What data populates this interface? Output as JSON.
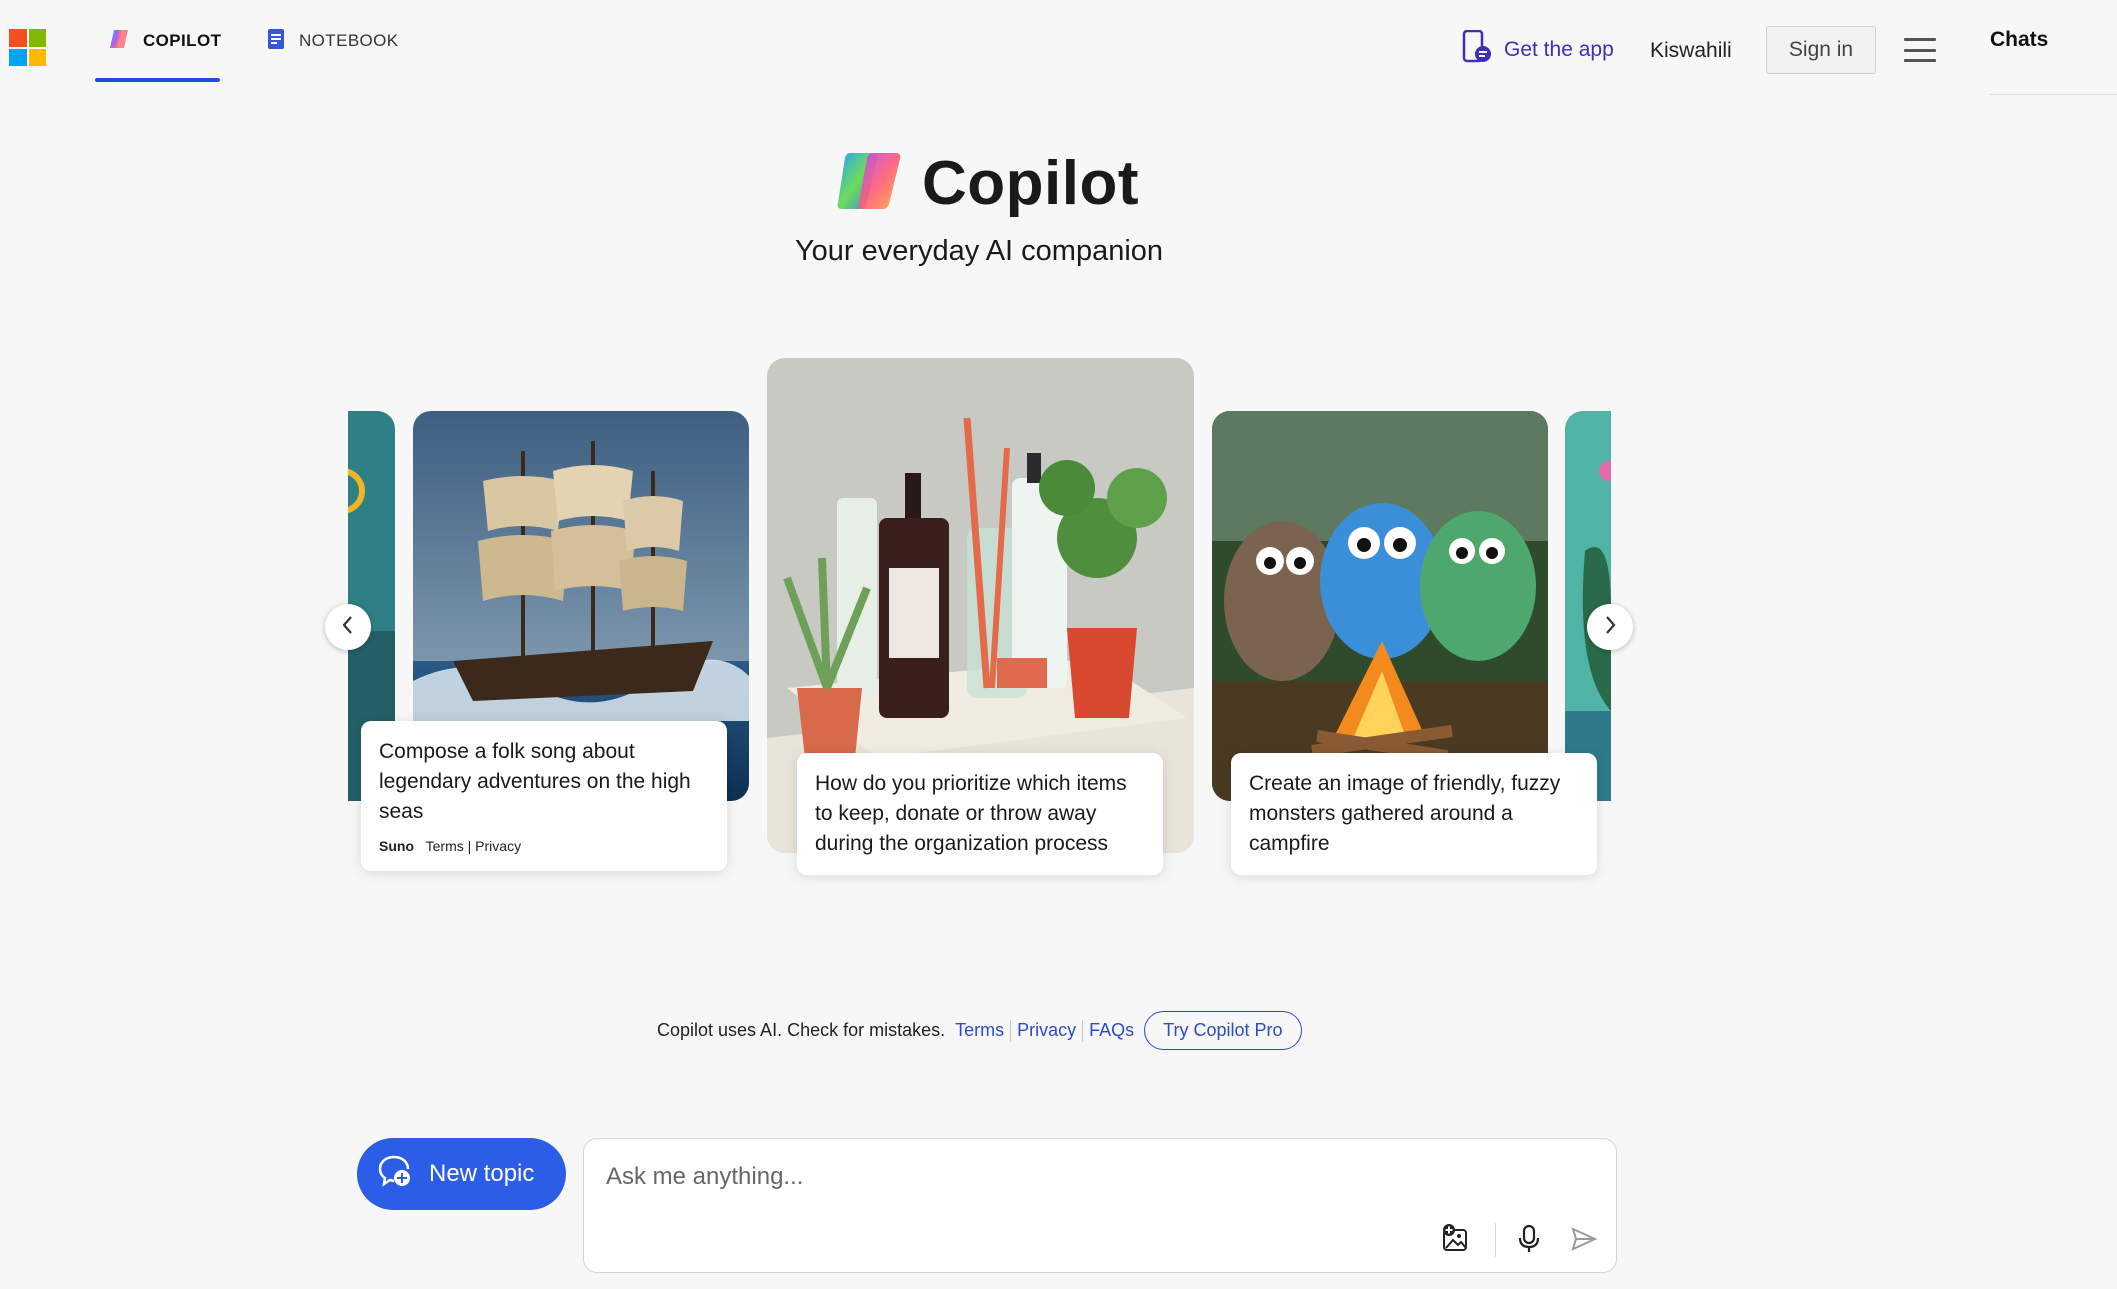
{
  "header": {
    "tabs": [
      {
        "label": "COPILOT",
        "active": true
      },
      {
        "label": "NOTEBOOK",
        "active": false
      }
    ],
    "get_app": "Get the app",
    "language": "Kiswahili",
    "sign_in": "Sign in",
    "chats": "Chats"
  },
  "hero": {
    "title": "Copilot",
    "subtitle": "Your everyday AI companion"
  },
  "carousel": {
    "cards": [
      {
        "caption": "Compose a folk song about legendary adventures on the high seas",
        "brand": "Suno",
        "links": "Terms | Privacy"
      },
      {
        "caption": "How do you prioritize which items to keep, donate or throw away during the organization process"
      },
      {
        "caption": "Create an image of friendly, fuzzy monsters gathered around a campfire"
      }
    ]
  },
  "disclaimer": {
    "text": "Copilot uses AI. Check for mistakes.",
    "terms": "Terms",
    "privacy": "Privacy",
    "faqs": "FAQs",
    "try_pro": "Try Copilot Pro"
  },
  "composer": {
    "new_topic": "New topic",
    "placeholder": "Ask me anything..."
  },
  "colors": {
    "accent": "#2b5de6",
    "link": "#2d4bc8",
    "get_app": "#3c2fb8"
  }
}
